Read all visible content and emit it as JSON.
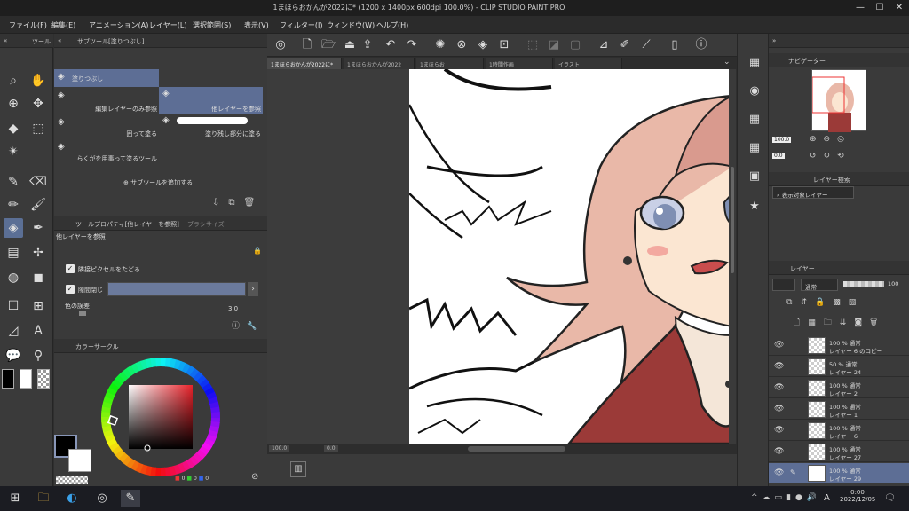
{
  "window": {
    "title": "1まほらおかんが2022に* (1200 x 1400px 600dpi 100.0%)  - CLIP STUDIO PAINT PRO",
    "minimize": "—",
    "maximize": "☐",
    "close": "✕"
  },
  "menu": [
    "ファイル(F)",
    "編集(E)",
    "アニメーション(A)",
    "レイヤー(L)",
    "選択範囲(S)",
    "表示(V)",
    "フィルター(I)",
    "ウィンドウ(W)",
    "ヘルプ(H)"
  ],
  "subtool_panel": {
    "tab_label": "サブツール[塗りつぶし]",
    "tool_tab": "ツール",
    "items": [
      {
        "label": "塗りつぶし",
        "selected": true
      },
      {
        "label": "編集レイヤーのみ参照",
        "selected": false
      },
      {
        "label": "他レイヤーを参照",
        "selected": true
      },
      {
        "label": "囲って塗る",
        "selected": false
      },
      {
        "label": "塗り残し部分に塗る",
        "selected": false
      },
      {
        "label": "らくがを用事って塗るツール",
        "selected": false
      }
    ],
    "add_subtool": "サブツールを追加する"
  },
  "tool_property": {
    "tab_label": "ツールプロパティ[他レイヤーを参照]",
    "tab2": "ブラシサイズ",
    "name": "他レイヤーを参照",
    "opt1": "隣接ピクセルをたどる",
    "opt2": "隙間閉じ",
    "opt3": "色の誤差",
    "value": "3.0"
  },
  "color_panel": {
    "tab_label": "カラーサークル",
    "rgb_r": "0",
    "rgb_g": "0",
    "rgb_b": "0",
    "hue_color": "#e8222a"
  },
  "tabs": [
    {
      "label": "1まほらおかんが2022に*",
      "active": true
    },
    {
      "label": "1まほらおかんが2022",
      "active": false
    },
    {
      "label": "1まほらお",
      "active": false
    },
    {
      "label": "1時間作画",
      "active": false
    },
    {
      "label": "イラスト",
      "active": false
    }
  ],
  "status": {
    "zoom": "100.0",
    "pos": "0.0"
  },
  "navigator": {
    "tab_label": "ナビゲーター",
    "zoom": "100.0",
    "angle": "0.0"
  },
  "layer_search": {
    "tab_label": "レイヤー検索",
    "filter": "表示対象レイヤー"
  },
  "layers_panel": {
    "tab_label": "レイヤー",
    "blend": "通常",
    "opacity": "100",
    "layers": [
      {
        "mode": "100 % 通常",
        "name": "レイヤー 6 のコピー"
      },
      {
        "mode": "50 % 通常",
        "name": "レイヤー 24"
      },
      {
        "mode": "100 % 通常",
        "name": "レイヤー 2"
      },
      {
        "mode": "100 % 通常",
        "name": "レイヤー 1"
      },
      {
        "mode": "100 % 通常",
        "name": "レイヤー 6"
      },
      {
        "mode": "100 % 通常",
        "name": "レイヤー 27"
      },
      {
        "mode": "100 % 通常",
        "name": "レイヤー 29"
      }
    ]
  },
  "taskbar": {
    "time": "0:00",
    "date": "2022/12/05",
    "lang": "A"
  }
}
